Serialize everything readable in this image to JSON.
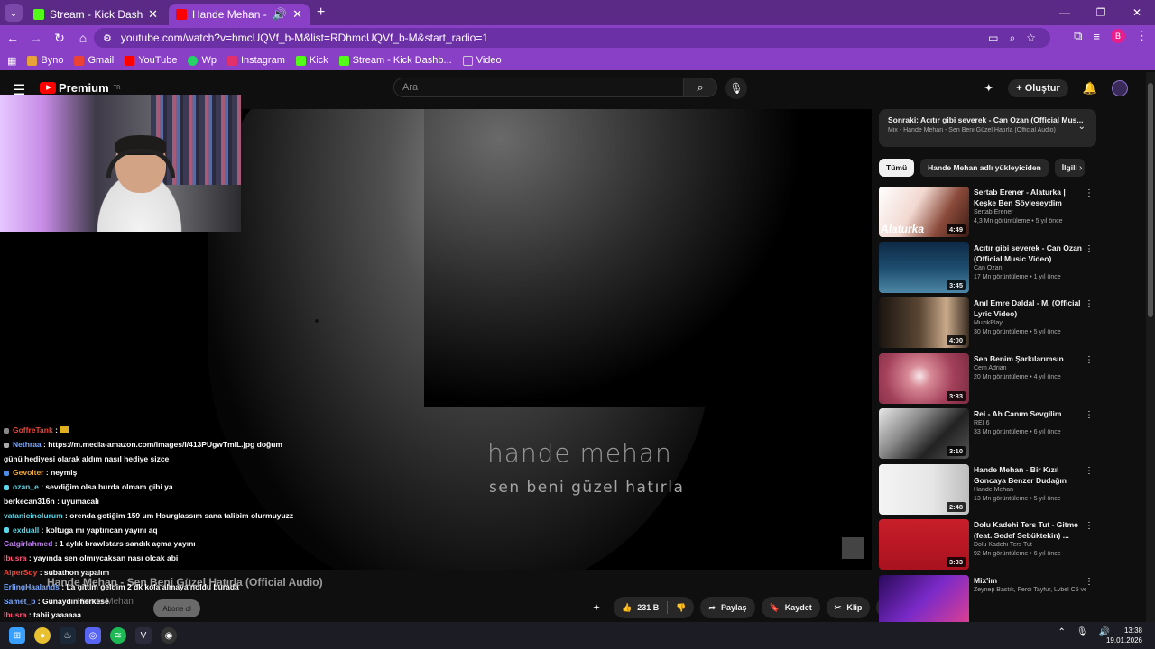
{
  "browser": {
    "tabs": [
      {
        "title": "Stream - Kick Dashboard",
        "favicon_color": "#53fc18"
      },
      {
        "title": "Hande Mehan - Sen Beni G",
        "favicon_color": "#ff0000"
      }
    ],
    "url": "youtube.com/watch?v=hmcUQVf_b-M&list=RDhmcUQVf_b-M&start_radio=1",
    "profile_initial": "B",
    "bookmarks": [
      {
        "label": "Byno",
        "color": "#e8a23a"
      },
      {
        "label": "Gmail",
        "color": "#ea4335"
      },
      {
        "label": "YouTube",
        "color": "#ff0000"
      },
      {
        "label": "Wp",
        "color": "#25d366"
      },
      {
        "label": "Instagram",
        "color": "#e1306c"
      },
      {
        "label": "Kick",
        "color": "#53fc18"
      },
      {
        "label": "Stream - Kick Dashb...",
        "color": "#53fc18"
      },
      {
        "label": "Video",
        "color": "#cccccc"
      }
    ]
  },
  "youtube": {
    "logo": "Premium",
    "logo_sup": "TR",
    "search_placeholder": "Ara",
    "create_label": "Oluştur",
    "artwork_title": "hande mehan",
    "artwork_subtitle": "sen beni güzel hatırla",
    "video_title": "Hande Mehan - Sen Beni Güzel Hatırla (Official Audio)",
    "channel_name": "Hande Mehan",
    "subscribe_label": "Abone ol",
    "likes": "231 B",
    "share_label": "Paylaş",
    "save_label": "Kaydet",
    "clip_label": "Klip",
    "up_next": {
      "line1": "Sonraki: Acıtır gibi severek - Can Ozan (Official Mus...",
      "line2": "Mix - Hande Mehan - Sen Beni Güzel Hatırla (Official Audio)"
    },
    "chips": [
      "Tümü",
      "Hande Mehan adlı yükleyiciden",
      "İlgili"
    ],
    "videos": [
      {
        "title": "Sertab Erener - Alaturka | Keşke Ben Söyleseydim",
        "channel": "Sertab Erener",
        "views": "4,3 Mn görüntüleme",
        "age": "5 yıl önce",
        "duration": "4:49",
        "thumb": "linear-gradient(120deg,#ffffff 0%,#f2d8d0 40%,#8a4a3a 70%,#3a1a14 100%)",
        "badge": "Alaturka"
      },
      {
        "title": "Acıtır gibi severek - Can Ozan (Official Music Video)",
        "channel": "Can Ozan",
        "views": "17 Mn görüntüleme",
        "age": "1 yıl önce",
        "duration": "3:45",
        "thumb": "linear-gradient(180deg,#0d2a46 0%,#1e4d6e 50%,#4d86a6 100%)",
        "badge": ""
      },
      {
        "title": "Anıl Emre Daldal - M. (Official Lyric Video)",
        "channel": "MuzikPlay",
        "views": "30 Mn görüntüleme",
        "age": "5 yıl önce",
        "duration": "4:00",
        "thumb": "linear-gradient(90deg,#1a1410 0%,#5a4634 45%,#c9a98a 75%,#3a2c22 100%)",
        "badge": ""
      },
      {
        "title": "Sen Benim Şarkılarımsın",
        "channel": "Cem Adrian",
        "views": "20 Mn görüntüleme",
        "age": "4 yıl önce",
        "duration": "3:33",
        "thumb": "radial-gradient(circle at 45% 45%,#f7e7ea 0%,#d88a97 20%,#a3405a 60%,#7a2a40 100%)",
        "badge": ""
      },
      {
        "title": "Rei - Ah Canım Sevgilim",
        "channel": "REİ 6",
        "views": "33 Mn görüntüleme",
        "age": "6 yıl önce",
        "duration": "3:10",
        "thumb": "linear-gradient(135deg,#e8e8e8 0%,#8a8a8a 35%,#222 65%,#555 100%)",
        "badge": ""
      },
      {
        "title": "Hande Mehan - Bir Kızıl Goncaya Benzer Dudağın",
        "channel": "Hande Mehan",
        "views": "13 Mn görüntüleme",
        "age": "5 yıl önce",
        "duration": "2:48",
        "thumb": "linear-gradient(90deg,#f4f4f4 0%,#e6e6e6 60%,#bdbdbd 100%)",
        "badge": ""
      },
      {
        "title": "Dolu Kadehi Ters Tut - Gitme (feat. Sedef Sebüktekin) ...",
        "channel": "Dolu Kadehi Ters Tut",
        "views": "92 Mn görüntüleme",
        "age": "6 yıl önce",
        "duration": "3:33",
        "thumb": "linear-gradient(180deg,#c81e2a 0%,#a8121e 100%)",
        "badge": ""
      },
      {
        "title": "Mix'im",
        "channel": "Zeynep Bastık, Ferdi Tayfur, Lvbel C5 ve d...",
        "views": "",
        "age": "",
        "duration": "",
        "thumb": "linear-gradient(135deg,#2a0a5a 0%,#7a2ac8 50%,#e04090 100%)",
        "badge": ""
      }
    ]
  },
  "chat": [
    {
      "user": "GoffreTank",
      "color": "#e9453b",
      "msg": "",
      "emoji": true
    },
    {
      "user": "Nethraa",
      "color": "#7aa7ff",
      "msg": "https://m.media-amazon.com/images/I/413PUgwTmIL.jpg doğum günü hediyesi olarak aldım nasıl hediye sizce",
      "wrap": true
    },
    {
      "user": "Gevolter",
      "color": "#f0a63a",
      "msg": "neymiş"
    },
    {
      "user": "ozan_e",
      "color": "#5bd5e8",
      "msg": "sevdiğim olsa burda olmam gibi ya"
    },
    {
      "user": "berkecan316n",
      "color": "#ffffff",
      "msg": "uyumacalı"
    },
    {
      "user": "vatanicinolurum",
      "color": "#5bd5e8",
      "msg": "orenda gotiğim 159 um Hourglassım sana talibim olurmuyuzz",
      "wrap": true
    },
    {
      "user": "exduall",
      "color": "#5bd5e8",
      "msg": "koltuga mı yaptırıcan yayını aq"
    },
    {
      "user": "Catgirlahmed",
      "color": "#c77dff",
      "msg": "1 aylık brawlstars sandık açma yayını"
    },
    {
      "user": "Ibusra",
      "color": "#ff5a7a",
      "msg": "yayında sen olmıycaksan nası olcak abi"
    },
    {
      "user": "AlperSoy",
      "color": "#e9453b",
      "msg": "subathon yapalım"
    },
    {
      "user": "ErlingHaalands",
      "color": "#7aa7ff",
      "msg": "La gittim geldim 2 dk kola almaya noldu burada"
    },
    {
      "user": "Samet_b",
      "color": "#7aa7ff",
      "msg": "Günaydın herkese"
    },
    {
      "user": "Ibusra",
      "color": "#ff5a7a",
      "msg": "tabii yaaaaaa"
    }
  ],
  "taskbar": {
    "time": "13:38",
    "date": "19.01.2026"
  }
}
